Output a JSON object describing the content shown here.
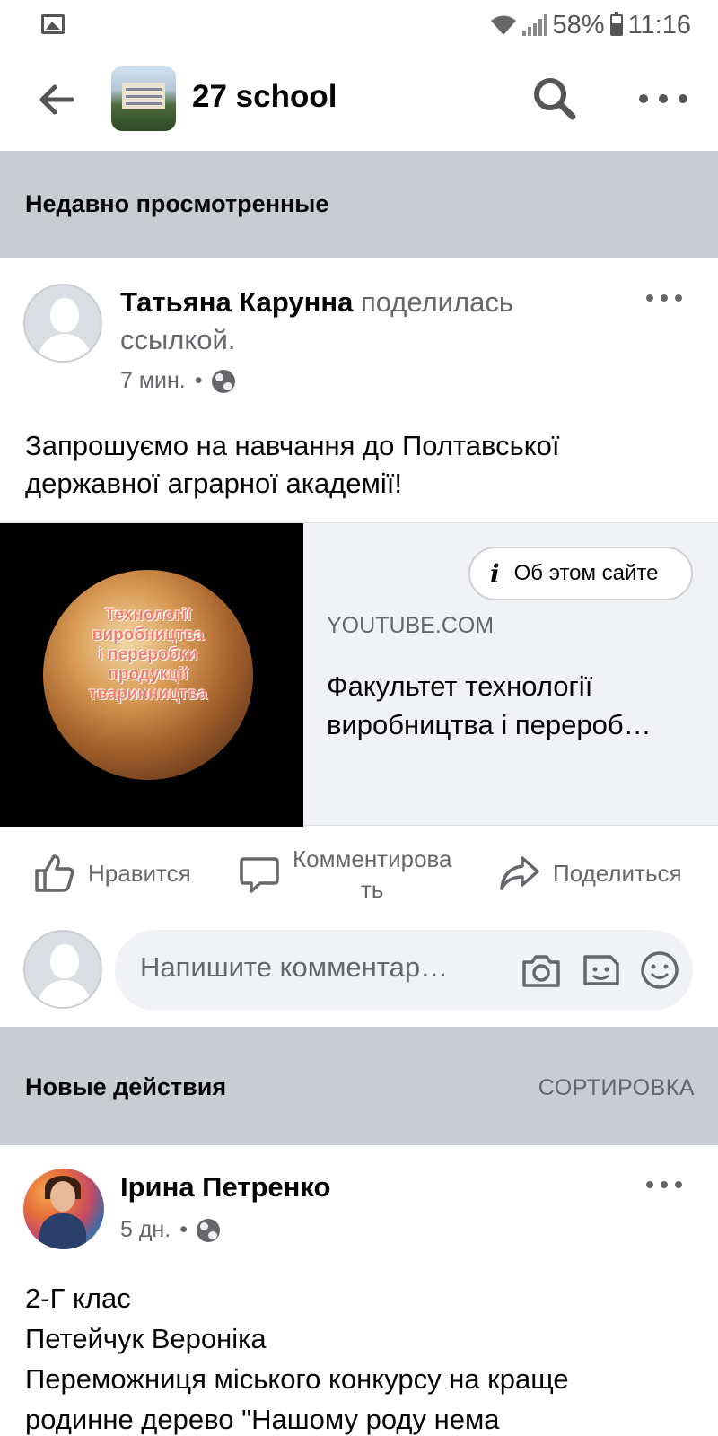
{
  "status_bar": {
    "battery_percent": "58%",
    "battery_level": 0.58,
    "time": "11:16",
    "icons": [
      "gallery-icon",
      "wifi-icon",
      "signal-icon",
      "battery-icon"
    ]
  },
  "header": {
    "title": "27 school",
    "icons": [
      "back-arrow-icon",
      "search-icon",
      "more-icon"
    ]
  },
  "sections": {
    "recent": "Недавно просмотренные",
    "new_activity": "Новые действия",
    "sort": "СОРТИРОВКА"
  },
  "post1": {
    "author": "Татьяна Карунна",
    "action": "поделилась ссылкой.",
    "time": "7 мин.",
    "dot": "•",
    "text_line1": "Запрошуємо на навчання до Полтавської",
    "text_line2": "державної аграрної академії!",
    "link": {
      "about_label": "Об этом сайте",
      "domain": "YOUTUBE.COM",
      "title_line1": "Факультет технології",
      "title_line2": "виробництва і перероб…",
      "thumb_text": [
        "Технології",
        "виробництва",
        "і переробки",
        "продукції",
        "тваринництва"
      ]
    }
  },
  "actions": {
    "like": "Нравится",
    "comment_line1": "Комментирова",
    "comment_line2": "ть",
    "share": "Поделиться"
  },
  "composer": {
    "placeholder": "Напишите комментар…"
  },
  "post2": {
    "author": "Ірина Петренко",
    "time": "5 дн.",
    "dot": "•",
    "lines": [
      "2-Г клас",
      "Петейчук Вероніка",
      "Переможниця міського конкурсу на краще",
      "родинне дерево \"Нашому роду нема"
    ]
  },
  "colors": {
    "section_bar": "#c9ccd1",
    "secondary_text": "#65676b",
    "link_card_bg": "#f0f2f5"
  }
}
